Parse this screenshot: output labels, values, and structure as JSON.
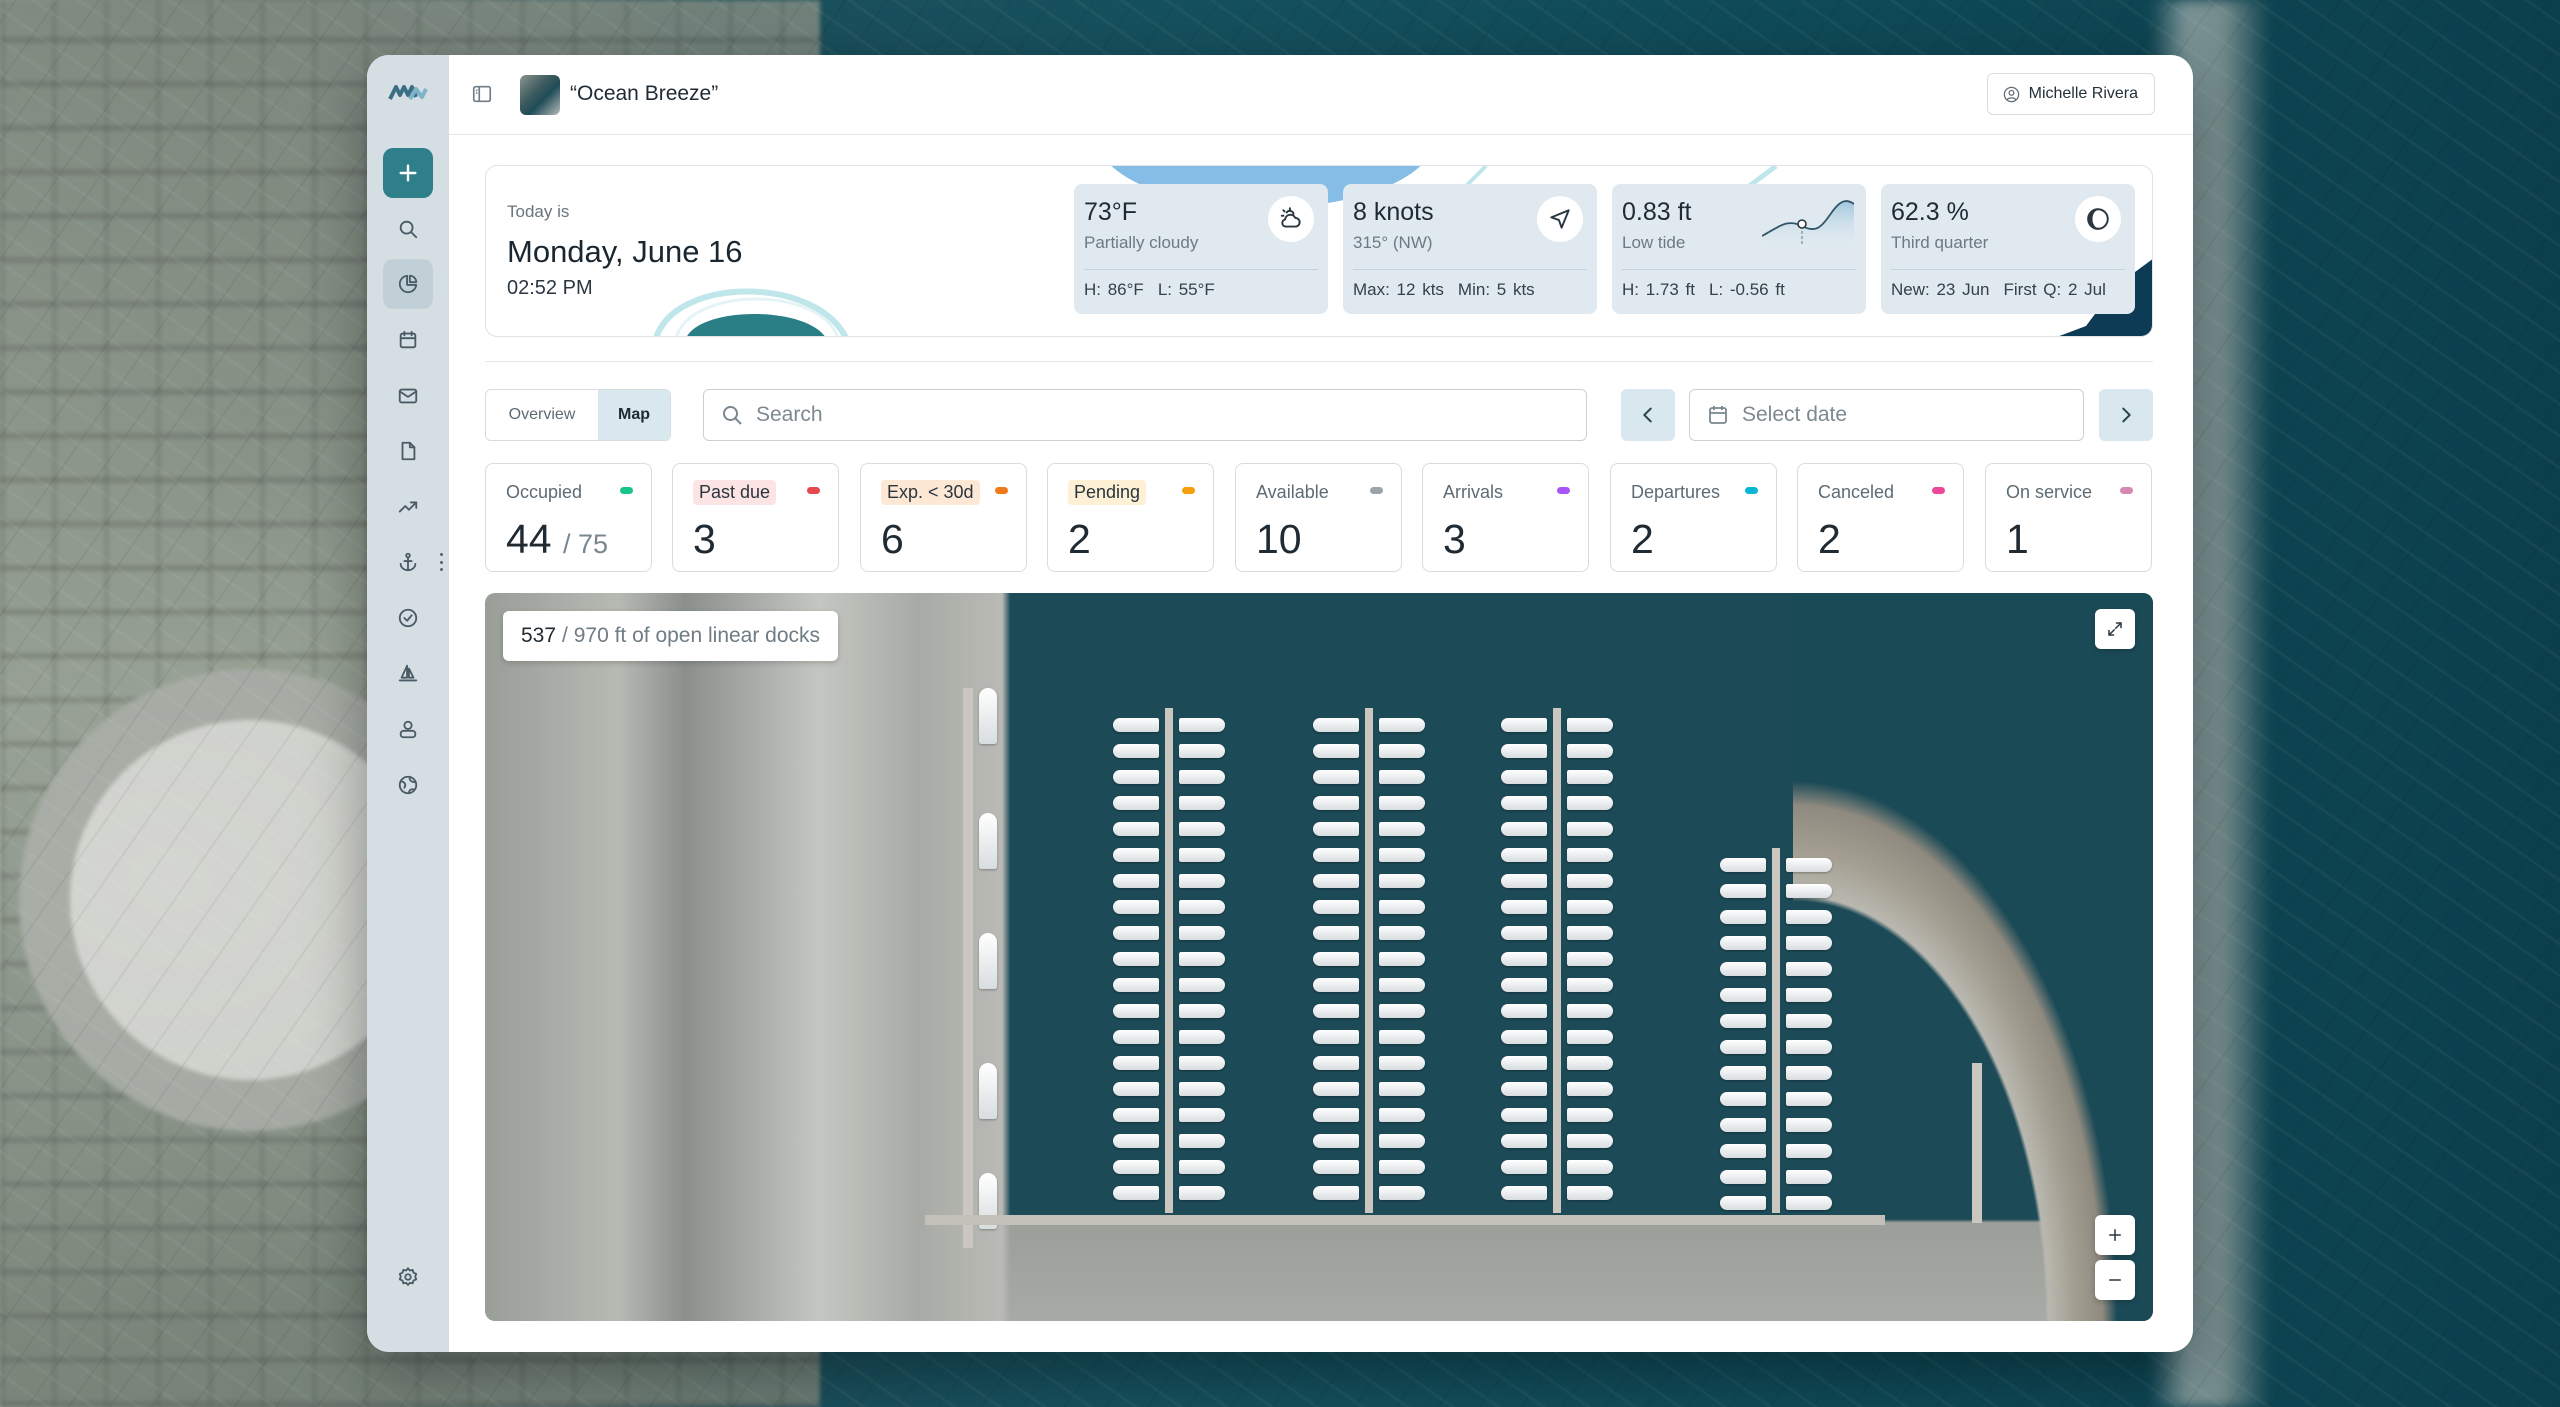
{
  "app": {
    "vessel_name": "“Ocean Breeze”",
    "user_name": "Michelle Rivera"
  },
  "sidebar": {
    "items": [
      {
        "icon": "plus-icon",
        "name": "new"
      },
      {
        "icon": "search-icon",
        "name": "search"
      },
      {
        "icon": "pie-chart-icon",
        "name": "dashboard",
        "active": true
      },
      {
        "icon": "calendar-icon",
        "name": "calendar"
      },
      {
        "icon": "mail-icon",
        "name": "mail"
      },
      {
        "icon": "document-icon",
        "name": "documents"
      },
      {
        "icon": "trending-up-icon",
        "name": "analytics"
      },
      {
        "icon": "anchor-icon",
        "name": "berths"
      },
      {
        "icon": "check-circle-icon",
        "name": "tasks"
      },
      {
        "icon": "sailboat-icon",
        "name": "vessels"
      },
      {
        "icon": "users-icon",
        "name": "customers"
      },
      {
        "icon": "globe-icon",
        "name": "map"
      },
      {
        "icon": "gear-icon",
        "name": "settings"
      }
    ]
  },
  "today": {
    "label": "Today is",
    "date": "Monday, June 16",
    "time": "02:52 PM"
  },
  "weather": {
    "temp": {
      "value": "73°F",
      "sub": "Partially cloudy",
      "high": "H: 86°F",
      "low": "L: 55°F",
      "icon": "partly-cloudy-icon"
    },
    "wind": {
      "value": "8 knots",
      "sub": "315° (NW)",
      "max": "Max: 12 kts",
      "min": "Min: 5 kts",
      "icon": "compass-arrow-icon"
    },
    "tide": {
      "value": "0.83 ft",
      "sub": "Low tide",
      "high": "H: 1.73 ft",
      "low": "L: -0.56 ft",
      "icon": "tide-chart-icon"
    },
    "moon": {
      "value": "62.3 %",
      "sub": "Third quarter",
      "new": "New: 23 Jun",
      "first": "First Q: 2 Jul",
      "icon": "moon-phase-icon"
    }
  },
  "view_tabs": {
    "overview": "Overview",
    "map": "Map",
    "active": "Map"
  },
  "search": {
    "placeholder": "Search"
  },
  "date_picker": {
    "placeholder": "Select date"
  },
  "stats": [
    {
      "label": "Occupied",
      "value": "44",
      "total": "/ 75",
      "color": "#19c48a",
      "pill": ""
    },
    {
      "label": "Past due",
      "value": "3",
      "color": "#e5484d",
      "pill": "#fde4e4"
    },
    {
      "label": "Exp. < 30d",
      "value": "6",
      "color": "#f07a1a",
      "pill": "#fde8d6"
    },
    {
      "label": "Pending",
      "value": "2",
      "color": "#f59e0b",
      "pill": "#fdf0d5"
    },
    {
      "label": "Available",
      "value": "10",
      "color": "#9aa4ab",
      "pill": ""
    },
    {
      "label": "Arrivals",
      "value": "3",
      "color": "#a855f7",
      "pill": ""
    },
    {
      "label": "Departures",
      "value": "2",
      "color": "#06b6d4",
      "pill": ""
    },
    {
      "label": "Canceled",
      "value": "2",
      "color": "#ec4899",
      "pill": ""
    },
    {
      "label": "On service",
      "value": "1",
      "color": "#d48ab0",
      "pill": ""
    }
  ],
  "map": {
    "open_docks": "537",
    "total_docks": "/ 970 ft of open linear docks"
  },
  "colors": {
    "accent": "#2f7f8a",
    "rail": "#d5dfe3",
    "card": "#dfe9ef"
  }
}
